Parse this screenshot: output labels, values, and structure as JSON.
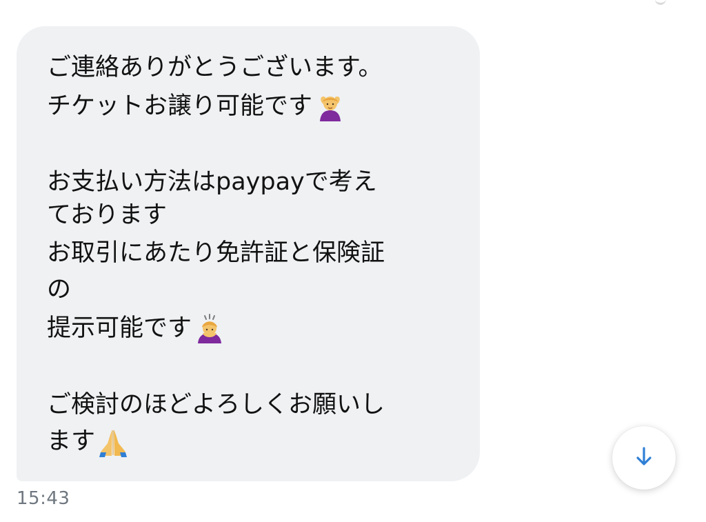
{
  "message": {
    "lines": [
      "ご連絡ありがとうございます。",
      "チケットお譲り可能です",
      "お支払い方法はpaypayで考え",
      "ております",
      "お取引にあたり免許証と保険証",
      "の",
      "提示可能です",
      "ご検討のほどよろしくお願いし",
      "ます"
    ],
    "emoji_1": "person-gesturing-ok-icon",
    "emoji_2": "person-bowing-icon",
    "emoji_3": "folded-hands-icon"
  },
  "timestamp": "15:43",
  "scroll_button": {
    "icon": "arrow-down-icon",
    "accent": "#2f7fd6"
  }
}
